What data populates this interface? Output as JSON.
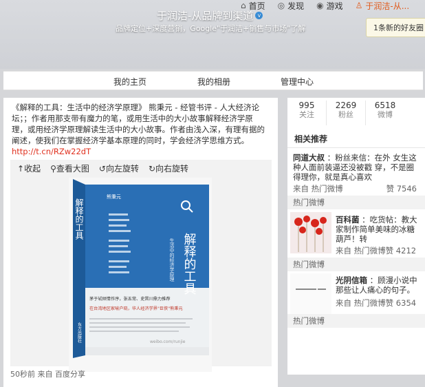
{
  "topnav": {
    "home": "首页",
    "discover": "发现",
    "games": "游戏",
    "user": "于润洁-从..."
  },
  "notification": "1条新的好友圈",
  "profile": {
    "name": "于润洁-从品牌到渠道",
    "desc": "品牌定位+深度营销，Google\"于润洁+销售与市场\"了解"
  },
  "tabs": [
    "我的主页",
    "我的相册",
    "管理中心"
  ],
  "post": {
    "text": "《解释的工具：生活中的经济学原理》 熊秉元 - 经管书评 - 人大经济论坛；；作者用那支带有魔力的笔，或用生活中的大小故事解释经济学原理，或用经济学原理解读生活中的大小故事。作者由浅入深，有理有据的阐述，使我们在掌握经济学基本原理的同时，学会经济学思维方式。",
    "link": "http://t.cn/RZw22dT",
    "tools": [
      "收起",
      "查看大图",
      "向左旋转",
      "向右旋转"
    ],
    "meta": "50秒前 来自 百度分享"
  },
  "book": {
    "title": "解释的工具",
    "subtitle": "生活中的经济学原理",
    "author": "熊秉元",
    "publisher": "东方出版社",
    "promo_line1": "茅于轼倾情作序，张五常、史晋川鼎力推荐",
    "promo_line2": "在台湾地区家喻户晓，华人经济学界\"巨侠\"熊秉元",
    "watermark": "weibo.com/runjie"
  },
  "stats": [
    {
      "num": "995",
      "label": "关注"
    },
    {
      "num": "2269",
      "label": "粉丝"
    },
    {
      "num": "6518",
      "label": "微博"
    }
  ],
  "recommend": {
    "title": "相关推荐",
    "items": [
      {
        "name": "同道大叔",
        "text": "：粉丝来信：在外 女生这种人面前装逼还没被戳 穿，不是圈得理你，就是真心喜欢",
        "from": "来自 热门微博",
        "likes": "赞 7546",
        "footer": "热门微博"
      },
      {
        "name": "百科菌",
        "text": "：吃货帖：教大家制作简单美味的冰糖葫芦！转",
        "from": "来自 热门微博",
        "likes": "赞 4212",
        "footer": "热门微博"
      },
      {
        "name": "光阴信箱",
        "text": "：顾漫小说中那些让人痛心的句子。",
        "from": "来自 热门微博",
        "likes": "赞 6354",
        "footer": "热门微博"
      }
    ]
  },
  "colors": {
    "accent": "#e0301e",
    "book_blue": "#2a6fb5",
    "user_orange": "#e05a1b"
  }
}
